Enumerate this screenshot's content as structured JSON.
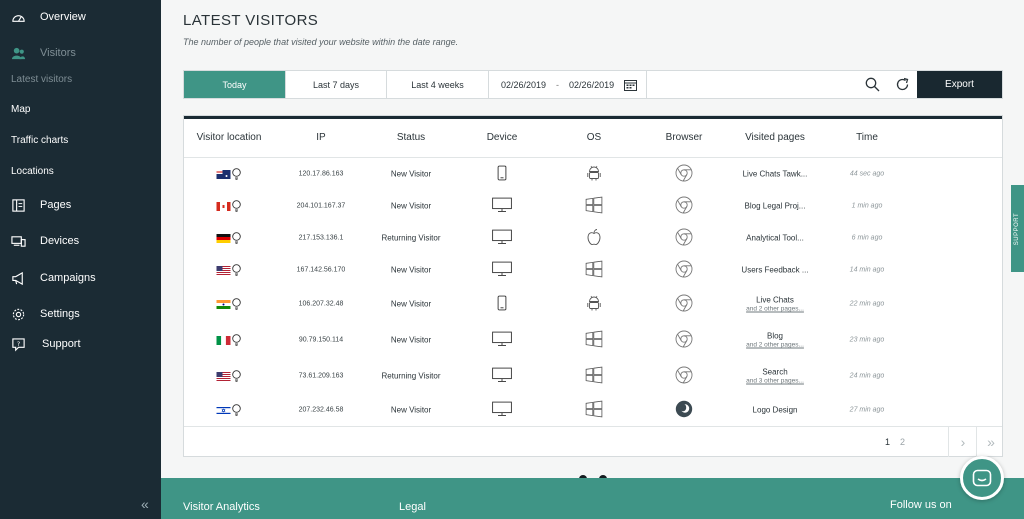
{
  "sidebar": {
    "items": [
      {
        "label": "Overview",
        "icon": "gauge-icon"
      },
      {
        "label": "Visitors",
        "icon": "users-icon"
      },
      {
        "label": "Latest visitors"
      },
      {
        "label": "Map"
      },
      {
        "label": "Traffic charts"
      },
      {
        "label": "Locations"
      },
      {
        "label": "Pages",
        "icon": "pages-icon"
      },
      {
        "label": "Devices",
        "icon": "devices-icon"
      },
      {
        "label": "Campaigns",
        "icon": "megaphone-icon"
      },
      {
        "label": "Settings",
        "icon": "gear-icon"
      },
      {
        "label": "Support",
        "icon": "help-icon"
      }
    ],
    "collapse_glyph": "«"
  },
  "main": {
    "title": "LATEST VISITORS",
    "subtitle": "The number of people that visited your website within the date range."
  },
  "toolbar": {
    "today": "Today",
    "last7": "Last 7 days",
    "last4w": "Last 4 weeks",
    "date_from": "02/26/2019",
    "date_sep": "-",
    "date_to": "02/26/2019",
    "export": "Export"
  },
  "table": {
    "headers": [
      "Visitor location",
      "IP",
      "Status",
      "Device",
      "OS",
      "Browser",
      "Visited pages",
      "Time"
    ],
    "rows": [
      {
        "flag": "au",
        "ip": "120.17.86.163",
        "status": "New Visitor",
        "device": "phone",
        "os": "android",
        "browser": "chrome",
        "page": "Live Chats Tawk...",
        "sub": "",
        "time": "44 sec ago"
      },
      {
        "flag": "ca",
        "ip": "204.101.167.37",
        "status": "New Visitor",
        "device": "desktop",
        "os": "windows",
        "browser": "chrome",
        "page": "Blog Legal Proj...",
        "sub": "",
        "time": "1 min ago"
      },
      {
        "flag": "de",
        "ip": "217.153.136.1",
        "status": "Returning Visitor",
        "device": "desktop",
        "os": "apple",
        "browser": "chrome",
        "page": "Analytical Tool...",
        "sub": "",
        "time": "6 min ago"
      },
      {
        "flag": "us",
        "ip": "167.142.56.170",
        "status": "New Visitor",
        "device": "desktop",
        "os": "windows",
        "browser": "chrome",
        "page": "Users Feedback ...",
        "sub": "",
        "time": "14 min ago"
      },
      {
        "flag": "in",
        "ip": "106.207.32.48",
        "status": "New Visitor",
        "device": "phone",
        "os": "android",
        "browser": "chrome",
        "page": "Live Chats",
        "sub": "and 2 other pages...",
        "time": "22 min ago"
      },
      {
        "flag": "it",
        "ip": "90.79.150.114",
        "status": "New Visitor",
        "device": "desktop",
        "os": "windows",
        "browser": "chrome",
        "page": "Blog",
        "sub": "and 2 other pages...",
        "time": "23 min ago"
      },
      {
        "flag": "us",
        "ip": "73.61.209.163",
        "status": "Returning Visitor",
        "device": "desktop",
        "os": "windows",
        "browser": "chrome",
        "page": "Search",
        "sub": "and 3 other pages...",
        "time": "24 min ago"
      },
      {
        "flag": "il",
        "ip": "207.232.46.58",
        "status": "New Visitor",
        "device": "desktop",
        "os": "windows",
        "browser": "firefox",
        "page": "Logo Design",
        "sub": "",
        "time": "27 min ago"
      }
    ]
  },
  "pagination": {
    "page1": "1",
    "page2": "2",
    "next": "›",
    "last": "»"
  },
  "support_tab": "SUPPORT",
  "footer": {
    "col1": "Visitor Analytics",
    "col2": "Legal",
    "col3": "Follow us on"
  },
  "colors": {
    "accent": "#3f9586",
    "sidebar": "#1b2b34",
    "export": "#192830"
  }
}
